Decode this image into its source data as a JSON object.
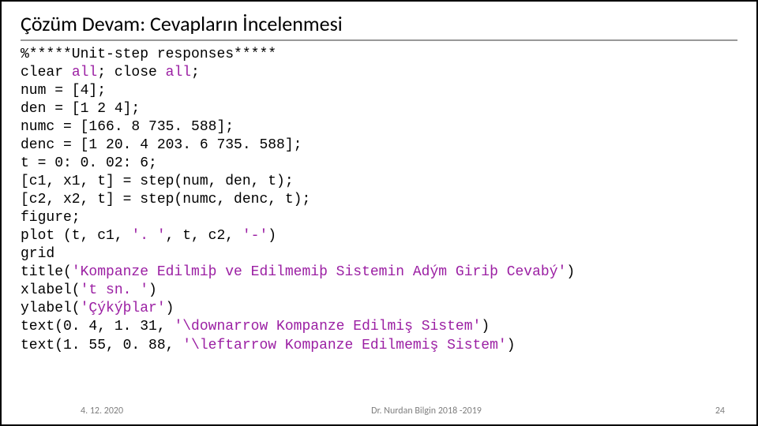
{
  "slide": {
    "title": "Çözüm Devam: Cevapların İncelenmesi",
    "code": {
      "l1": "%*****Unit-step responses*****",
      "l2a": "clear ",
      "l2b": "all",
      "l2c": "; close ",
      "l2d": "all",
      "l2e": ";",
      "l3": "num = [4];",
      "l4": "den = [1 2 4];",
      "l5": "numc = [166. 8 735. 588];",
      "l6": "denc = [1 20. 4 203. 6 735. 588];",
      "l7": "t = 0: 0. 02: 6;",
      "l8": "[c1, x1, t] = step(num, den, t);",
      "l9": "[c2, x2, t] = step(numc, denc, t);",
      "l10": "figure;",
      "l11a": "plot (t, c1, ",
      "l11b": "'. '",
      "l11c": ", t, c2, ",
      "l11d": "'-'",
      "l11e": ")",
      "l12": "grid",
      "l13a": "title(",
      "l13b": "'Kompanze Edilmiþ ve Edilmemiþ Sistemin Adým Giriþ Cevabý'",
      "l13c": ")",
      "l14a": "xlabel(",
      "l14b": "'t sn. '",
      "l14c": ")",
      "l15a": "ylabel(",
      "l15b": "'Çýkýþlar'",
      "l15c": ")",
      "l16a": "text(0. 4, 1. 31, ",
      "l16b": "'\\downarrow Kompanze Edilmiş Sistem'",
      "l16c": ")",
      "l17a": "text(1. 55, 0. 88, ",
      "l17b": "'\\leftarrow Kompanze Edilmemiş Sistem'",
      "l17c": ")"
    }
  },
  "footer": {
    "date": "4. 12. 2020",
    "author": "Dr. Nurdan Bilgin 2018 -2019",
    "page": "24"
  }
}
